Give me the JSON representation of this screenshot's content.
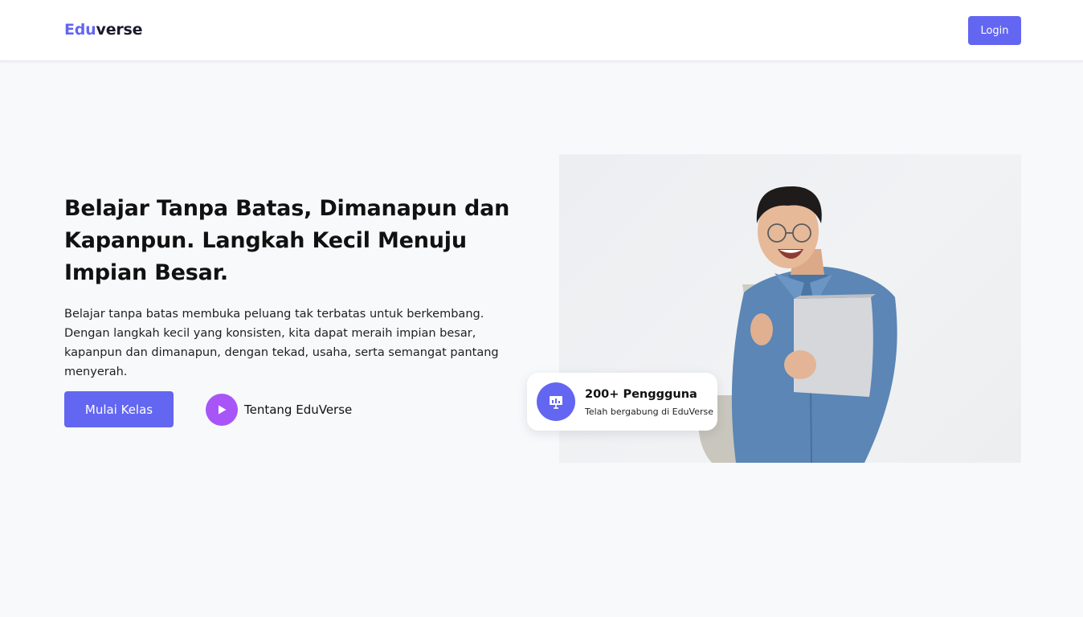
{
  "nav": {
    "brand_accent": "Edu",
    "brand_rest": "verse",
    "login_label": "Login"
  },
  "hero": {
    "title": "Belajar Tanpa Batas, Dimanapun dan Kapanpun. Langkah Kecil Menuju Impian Besar.",
    "description": "Belajar tanpa batas membuka peluang tak terbatas untuk berkembang. Dengan langkah kecil yang konsisten, kita dapat meraih impian besar, kapanpun dan dimanapun, dengan tekad, usaha, serta semangat pantang menyerah.",
    "cta_label": "Mulai Kelas",
    "secondary_label": "Tentang EduVerse"
  },
  "stat": {
    "value": "200+ Penggguna",
    "label": "Telah bergabung di EduVerse"
  },
  "icons": {
    "play": "play-icon",
    "stat": "presentation-chart-icon"
  },
  "colors": {
    "primary": "#6366f1",
    "play_accent": "#a855f7",
    "background": "#f8f9fb"
  }
}
